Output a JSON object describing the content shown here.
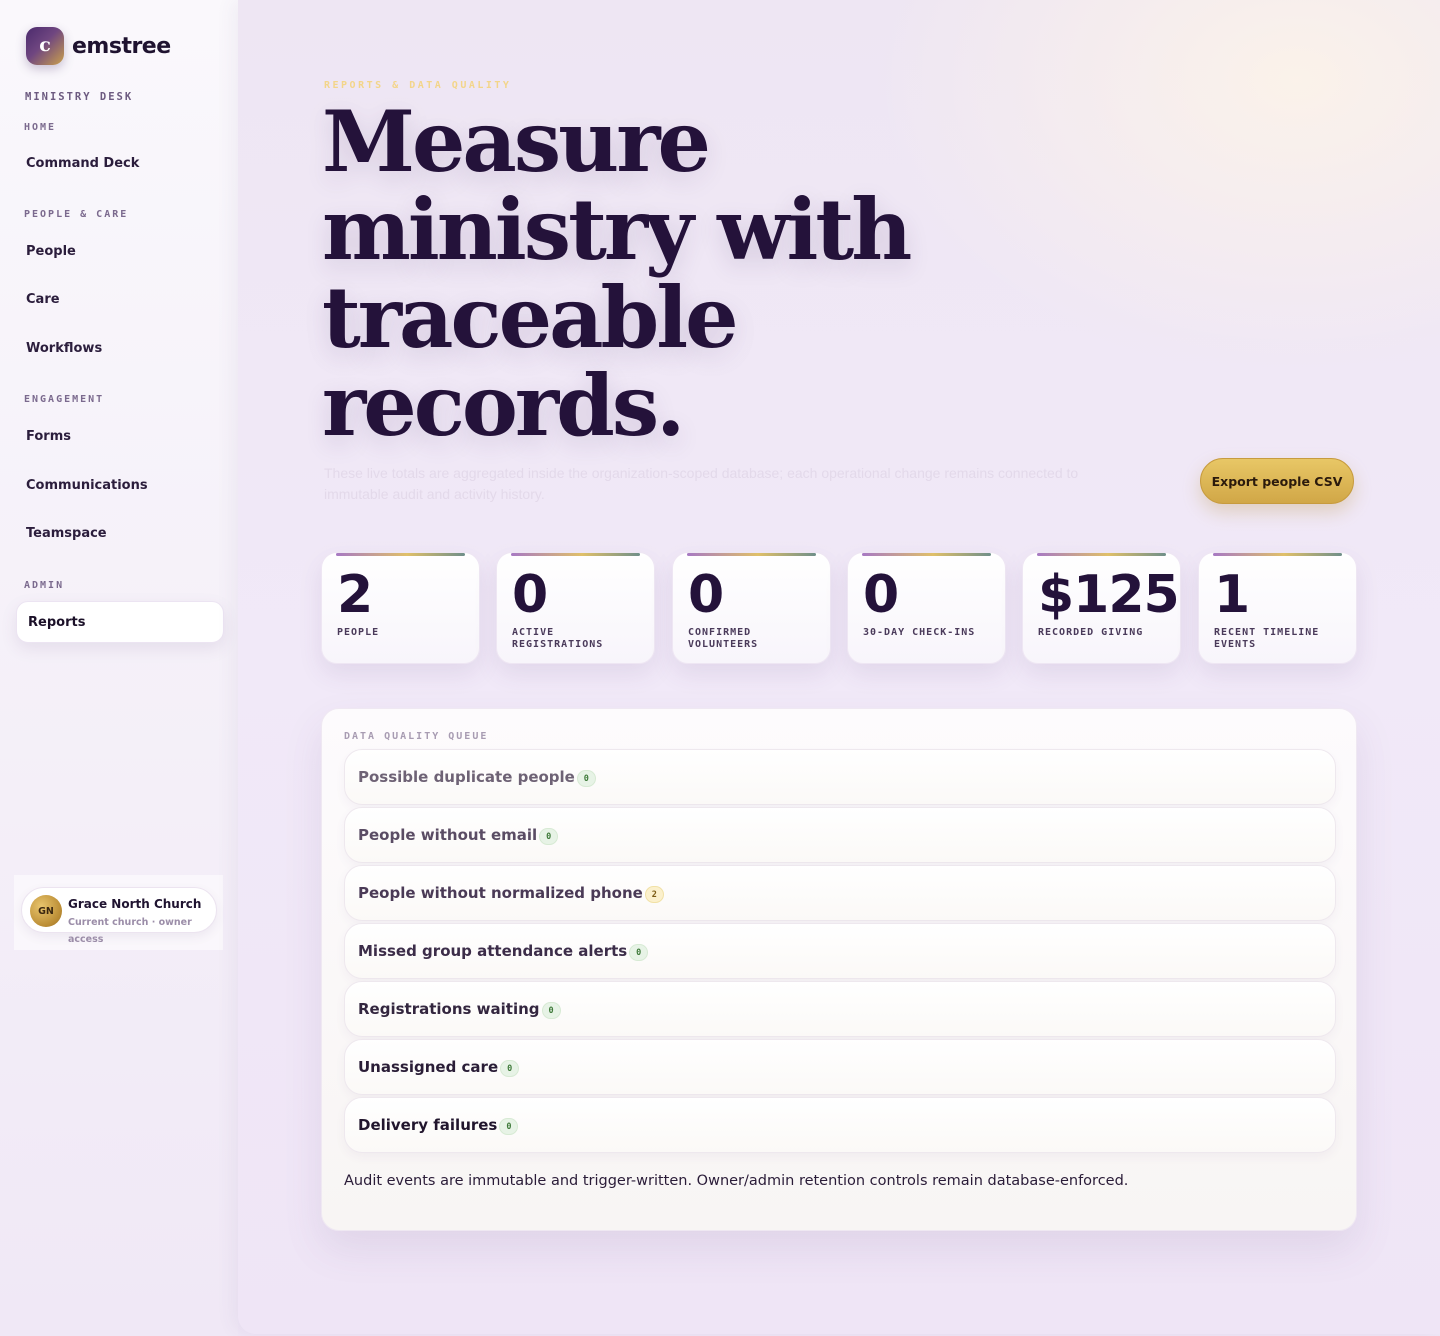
{
  "brand": {
    "mark": "c",
    "name": "emstree"
  },
  "sidebar": {
    "eyebrow": "MINISTRY DESK",
    "groups": [
      {
        "label": "HOME",
        "items": [
          {
            "label": "Command Deck"
          }
        ]
      },
      {
        "label": "PEOPLE & CARE",
        "items": [
          {
            "label": "People"
          },
          {
            "label": "Care"
          },
          {
            "label": "Workflows"
          }
        ]
      },
      {
        "label": "ENGAGEMENT",
        "items": [
          {
            "label": "Forms"
          },
          {
            "label": "Communications"
          },
          {
            "label": "Teamspace"
          }
        ]
      },
      {
        "label": "ADMIN",
        "items": [
          {
            "label": "Reports",
            "active": true
          }
        ]
      }
    ],
    "church": {
      "initials": "GN",
      "name": "Grace North Church",
      "subtitle": "Current church · owner access"
    }
  },
  "page": {
    "eyebrow": "REPORTS & DATA QUALITY",
    "title": "Measure ministry with traceable records.",
    "lede": "These live totals are aggregated inside the organization-scoped database; each operational change remains connected to immutable audit and activity history.",
    "export_label": "Export people CSV"
  },
  "stats": [
    {
      "value": "2",
      "label": "PEOPLE"
    },
    {
      "value": "0",
      "label": "ACTIVE REGISTRATIONS"
    },
    {
      "value": "0",
      "label": "CONFIRMED VOLUNTEERS"
    },
    {
      "value": "0",
      "label": "30-DAY CHECK-INS"
    },
    {
      "value": "$125.00",
      "label": "RECORDED GIVING"
    },
    {
      "value": "1",
      "label": "RECENT TIMELINE EVENTS"
    }
  ],
  "queue": {
    "title": "DATA QUALITY QUEUE",
    "items": [
      {
        "label": "Possible duplicate people",
        "count": "0",
        "color": "#6e6275"
      },
      {
        "label": "People without email",
        "count": "0",
        "color": "#5a4c64"
      },
      {
        "label": "People without normalized phone",
        "count": "2",
        "color": "#4a3a56",
        "warn": true
      },
      {
        "label": "Missed group attendance alerts",
        "count": "0",
        "color": "#3c2d49"
      },
      {
        "label": "Registrations waiting",
        "count": "0",
        "color": "#33263f"
      },
      {
        "label": "Unassigned care",
        "count": "0",
        "color": "#2a1d37"
      },
      {
        "label": "Delivery failures",
        "count": "0",
        "color": "#21152d"
      }
    ],
    "note": "Audit events are immutable and trigger-written. Owner/admin retention controls remain database-enforced."
  }
}
